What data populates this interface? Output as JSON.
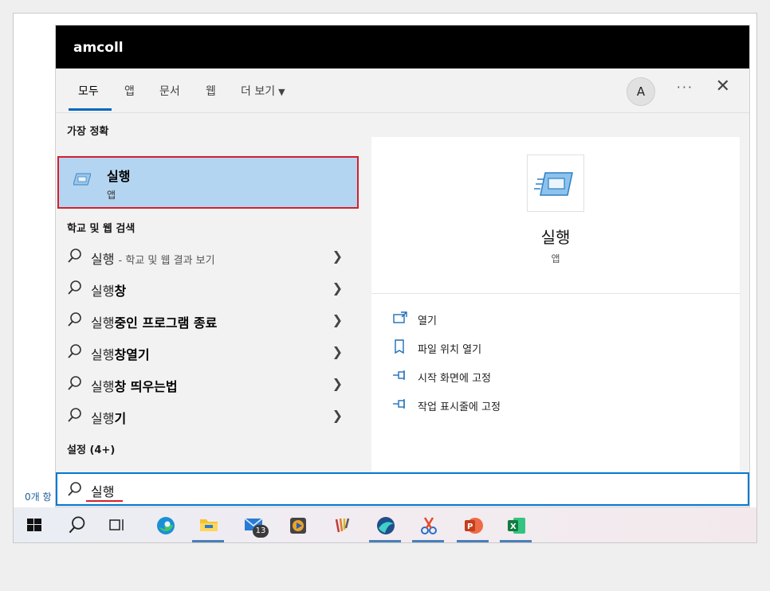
{
  "menu": {
    "title": "amcoll",
    "tabs": [
      {
        "label": "모두"
      },
      {
        "label": "앱"
      },
      {
        "label": "문서"
      },
      {
        "label": "웹"
      },
      {
        "label": "더 보기"
      }
    ],
    "avatar_initial": "A",
    "more_glyph": "···",
    "close_glyph": "✕"
  },
  "best_match": {
    "header": "가장 정확",
    "title": "실행",
    "subtitle": "앱",
    "icon": "run-app-icon"
  },
  "web_search": {
    "header": "학교 및 웹 검색",
    "items": [
      {
        "prefix": "실행",
        "bold": "",
        "suffix": "- 학교 및 웹 결과 보기"
      },
      {
        "prefix": "실행",
        "bold": "창",
        "suffix": ""
      },
      {
        "prefix": "실행",
        "bold": "중인 프로그램 종료",
        "suffix": ""
      },
      {
        "prefix": "실행",
        "bold": "창열기",
        "suffix": ""
      },
      {
        "prefix": "실행",
        "bold": "창 띄우는법",
        "suffix": ""
      },
      {
        "prefix": "실행",
        "bold": "기",
        "suffix": ""
      }
    ]
  },
  "settings_header": "설정 (4+)",
  "detail": {
    "title": "실행",
    "subtitle": "앱",
    "actions": [
      {
        "label": "열기",
        "icon": "open-icon"
      },
      {
        "label": "파일 위치 열기",
        "icon": "file-location-icon"
      },
      {
        "label": "시작 화면에 고정",
        "icon": "pin-icon"
      },
      {
        "label": "작업 표시줄에 고정",
        "icon": "pin-icon"
      }
    ]
  },
  "search": {
    "value": "실행"
  },
  "background_text": "0개 항",
  "taskbar": {
    "mail_badge": "13"
  },
  "colors": {
    "accent": "#0078d4",
    "selection": "#b4d5f1",
    "highlight_border": "#d61f2c"
  }
}
